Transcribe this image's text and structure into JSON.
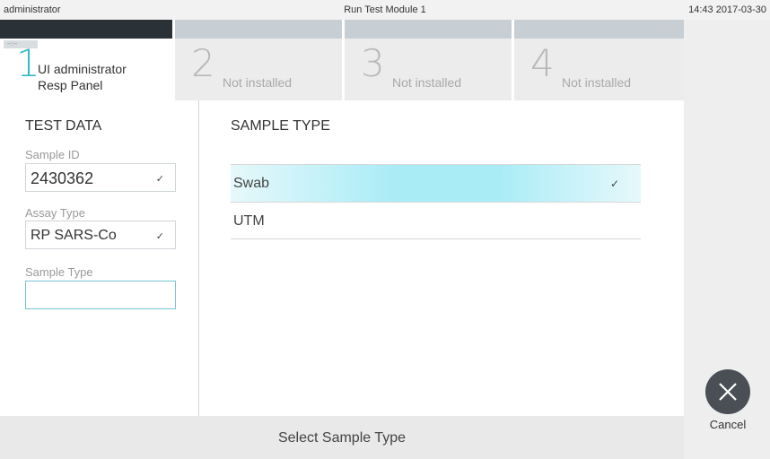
{
  "topbar": {
    "user": "administrator",
    "title": "Run Test Module 1",
    "clock": "14:43 2017-03-30"
  },
  "tabs": [
    {
      "number": "1",
      "line1": "UI administrator",
      "line2": "Resp Panel",
      "mini": "--:--"
    },
    {
      "number": "2",
      "label": "Not installed"
    },
    {
      "number": "3",
      "label": "Not installed"
    },
    {
      "number": "4",
      "label": "Not installed"
    }
  ],
  "test_data": {
    "title": "TEST DATA",
    "sample_id_label": "Sample ID",
    "sample_id_value": "2430362",
    "assay_type_label": "Assay Type",
    "assay_type_value": "RP SARS-Co",
    "sample_type_label": "Sample Type",
    "sample_type_value": ""
  },
  "sample_type": {
    "title": "SAMPLE TYPE",
    "options": [
      {
        "label": "Swab",
        "selected": true
      },
      {
        "label": "UTM",
        "selected": false
      }
    ]
  },
  "cancel": {
    "label": "Cancel",
    "icon": "close-icon"
  },
  "bottom": {
    "message": "Select Sample Type"
  },
  "colors": {
    "accent": "#35b9c6",
    "selected_row": "#a9ecf6",
    "dark_tab": "#2a3137"
  }
}
